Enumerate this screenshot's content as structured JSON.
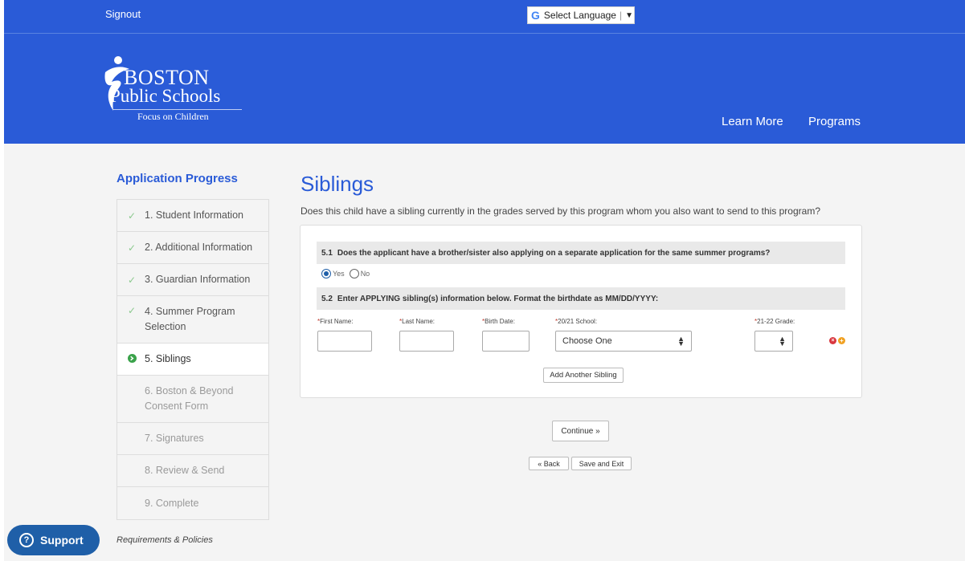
{
  "topbar": {
    "signout": "Signout",
    "translate_label": "Select Language",
    "translate_arrow": "▼"
  },
  "logo": {
    "line1": "BOSTON",
    "line2": "Public Schools",
    "line3": "Focus on Children"
  },
  "nav": {
    "learn_more": "Learn More",
    "programs": "Programs"
  },
  "sidebar": {
    "title": "Application Progress",
    "steps": [
      {
        "label": "1. Student Information",
        "state": "done"
      },
      {
        "label": "2. Additional Information",
        "state": "done"
      },
      {
        "label": "3. Guardian Information",
        "state": "done"
      },
      {
        "label": "4. Summer Program Selection",
        "state": "done"
      },
      {
        "label": "5. Siblings",
        "state": "current"
      },
      {
        "label": "6. Boston & Beyond Consent Form",
        "state": "future"
      },
      {
        "label": "7. Signatures",
        "state": "future"
      },
      {
        "label": "8. Review & Send",
        "state": "future"
      },
      {
        "label": "9. Complete",
        "state": "future"
      }
    ],
    "requirements_link": "Requirements & Policies"
  },
  "support": {
    "label": "Support"
  },
  "main": {
    "title": "Siblings",
    "question": "Does this child have a sibling currently in the grades served by this program whom you also want to send to this program?",
    "q1": {
      "number": "5.1",
      "text": "Does the applicant have a brother/sister also applying on a separate application for the same summer programs?",
      "options": [
        "Yes",
        "No"
      ],
      "selected": "Yes"
    },
    "q2": {
      "number": "5.2",
      "text": "Enter APPLYING sibling(s) information below. Format the birthdate as MM/DD/YYYY:"
    },
    "fields": {
      "required_mark": "*",
      "first_name_label": "First Name:",
      "last_name_label": "Last Name:",
      "birth_date_label": "Birth Date:",
      "school_label": "20/21 School:",
      "grade_label": "21-22 Grade:",
      "first_name_value": "",
      "last_name_value": "",
      "birth_date_value": "",
      "school_value": "Choose One",
      "grade_value": ""
    },
    "add_sibling_button": "Add Another Sibling",
    "continue_button": "Continue »",
    "back_button": "« Back",
    "save_exit_button": "Save and Exit"
  },
  "colors": {
    "header_blue": "#2a5bd7",
    "support_blue": "#1f5fa8",
    "check_green": "#8bc98e",
    "active_green": "#3aa24a",
    "remove_red": "#d9363e",
    "add_orange": "#f0a020"
  },
  "icons": {
    "done_step": "checkmark-icon",
    "current_step": "arrow-circle-right-icon",
    "remove_row": "remove-circle-icon",
    "add_row": "add-circle-icon",
    "support": "question-circle-icon",
    "google": "google-g-icon"
  }
}
